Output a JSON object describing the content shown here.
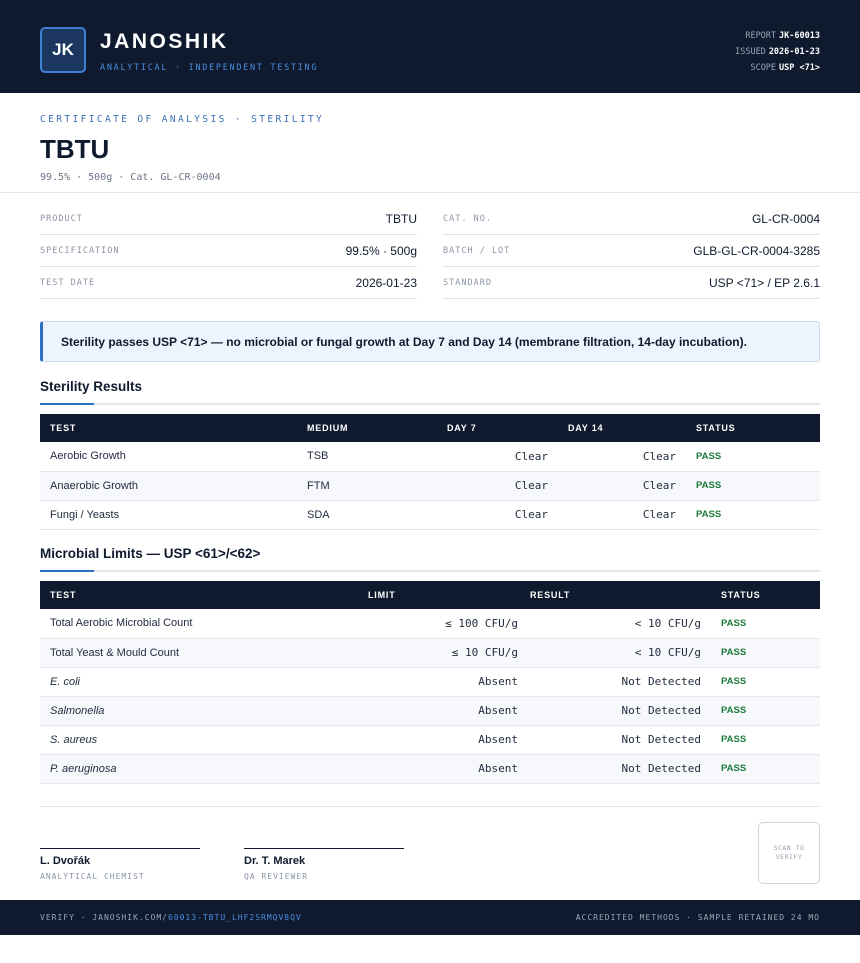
{
  "header": {
    "logo": "JK",
    "brand": "JANOSHIK",
    "tagline": "ANALYTICAL · INDEPENDENT TESTING",
    "report_label": "REPORT",
    "report_value": "JK-60013",
    "issued_label": "ISSUED",
    "issued_value": "2026-01-23",
    "scope_label": "SCOPE",
    "scope_value": "USP <71>"
  },
  "title_block": {
    "kicker": "CERTIFICATE OF ANALYSIS · STERILITY",
    "title": "TBTU",
    "subtitle": "99.5% · 500g  ·  Cat. GL-CR-0004"
  },
  "info": {
    "left": [
      {
        "label": "PRODUCT",
        "value": "TBTU"
      },
      {
        "label": "SPECIFICATION",
        "value": "99.5% · 500g"
      },
      {
        "label": "TEST DATE",
        "value": "2026-01-23"
      }
    ],
    "right": [
      {
        "label": "CAT. NO.",
        "value": "GL-CR-0004"
      },
      {
        "label": "BATCH / LOT",
        "value": "GLB-GL-CR-0004-3285"
      },
      {
        "label": "STANDARD",
        "value": "USP <71> / EP 2.6.1"
      }
    ]
  },
  "notice": "Sterility passes USP <71> — no microbial or fungal growth at Day 7 and Day 14 (membrane filtration, 14-day incubation).",
  "sterility": {
    "title": "Sterility Results",
    "headers": [
      "TEST",
      "MEDIUM",
      "DAY 7",
      "DAY 14",
      "STATUS"
    ],
    "rows": [
      {
        "test": "Aerobic Growth",
        "medium": "TSB",
        "day7": "Clear",
        "day14": "Clear",
        "status": "PASS"
      },
      {
        "test": "Anaerobic Growth",
        "medium": "FTM",
        "day7": "Clear",
        "day14": "Clear",
        "status": "PASS"
      },
      {
        "test": "Fungi / Yeasts",
        "medium": "SDA",
        "day7": "Clear",
        "day14": "Clear",
        "status": "PASS"
      }
    ]
  },
  "microbial": {
    "title": "Microbial Limits — USP <61>/<62>",
    "headers": [
      "TEST",
      "LIMIT",
      "RESULT",
      "STATUS"
    ],
    "rows": [
      {
        "test": "Total Aerobic Microbial Count",
        "limit": "≤ 100 CFU/g",
        "result": "< 10 CFU/g",
        "status": "PASS"
      },
      {
        "test": "Total Yeast & Mould Count",
        "limit": "≤ 10 CFU/g",
        "result": "< 10 CFU/g",
        "status": "PASS"
      },
      {
        "test": "E. coli",
        "limit": "Absent",
        "result": "Not Detected",
        "status": "PASS"
      },
      {
        "test": "Salmonella",
        "limit": "Absent",
        "result": "Not Detected",
        "status": "PASS"
      },
      {
        "test": "S. aureus",
        "limit": "Absent",
        "result": "Not Detected",
        "status": "PASS"
      },
      {
        "test": "P. aeruginosa",
        "limit": "Absent",
        "result": "Not Detected",
        "status": "PASS"
      }
    ]
  },
  "signatures": [
    {
      "name": "L. Dvořák",
      "role": "ANALYTICAL CHEMIST"
    },
    {
      "name": "Dr. T. Marek",
      "role": "QA REVIEWER"
    }
  ],
  "qr": {
    "text": "SCAN TO VERIFY"
  },
  "footer": {
    "verify_prefix": "VERIFY · JANOSHIK.COM/",
    "verify_link": "60013-TBTU_LHF2SRMQV8QV",
    "right": "ACCREDITED METHODS · SAMPLE RETAINED 24 MO"
  },
  "colors": {
    "navy": "#0f1a2e",
    "accent_blue": "#2d6fc3",
    "pass_green": "#1c7a3a"
  }
}
